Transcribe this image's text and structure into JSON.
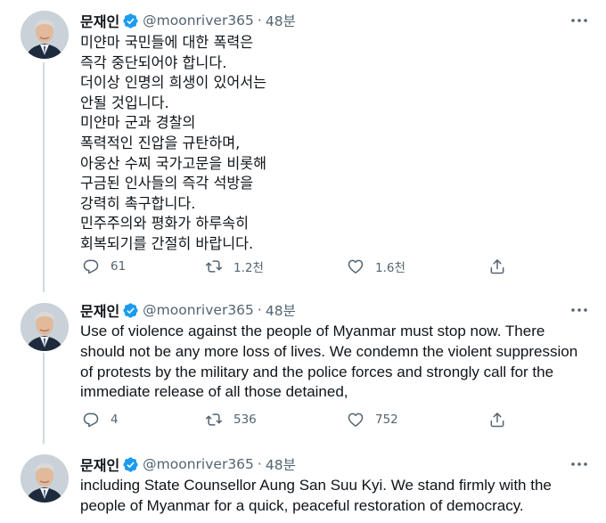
{
  "tweets": [
    {
      "name": "문재인",
      "handle": "@moonriver365",
      "dot": "·",
      "time": "48분",
      "text": "미얀마 국민들에 대한 폭력은\n즉각 중단되어야 합니다.\n더이상 인명의 희생이 있어서는\n안될 것입니다.\n미얀마 군과 경찰의\n폭력적인 진압을 규탄하며,\n아웅산 수찌 국가고문을 비롯해\n구금된 인사들의 즉각 석방을\n강력히 촉구합니다.\n민주주의와 평화가 하루속히\n회복되기를 간절히 바랍니다.",
      "replies": "61",
      "retweets": "1.2천",
      "likes": "1.6천"
    },
    {
      "name": "문재인",
      "handle": "@moonriver365",
      "dot": "·",
      "time": "48분",
      "text": "Use of violence against the people of Myanmar must stop now. There should not be any more loss of lives. We condemn the violent suppression of protests by the military and the police forces and strongly call for the immediate release of all those detained,",
      "replies": "4",
      "retweets": "536",
      "likes": "752"
    },
    {
      "name": "문재인",
      "handle": "@moonriver365",
      "dot": "·",
      "time": "48분",
      "text": "including State Counsellor Aung San Suu Kyi. We stand firmly with the people of Myanmar for a quick, peaceful restoration of democracy."
    }
  ],
  "icons": {
    "verified": "verified-badge-icon",
    "more": "more-dots-icon",
    "reply": "reply-bubble-icon",
    "retweet": "retweet-arrows-icon",
    "like": "heart-outline-icon",
    "share": "share-upload-icon"
  },
  "colors": {
    "text": "#0f1419",
    "secondary": "#536471",
    "verified": "#1d9bf0",
    "thread_line": "#cfd9de"
  }
}
